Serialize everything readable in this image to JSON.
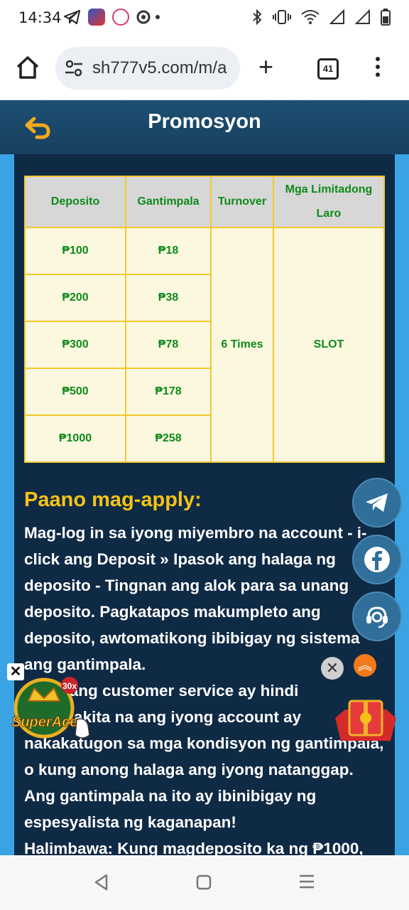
{
  "status_bar": {
    "time": "14:34",
    "left_icons": [
      "telegram-icon",
      "app-badge-icon",
      "app-badge-icon",
      "gear-dot-icon"
    ],
    "right_icons": [
      "bluetooth-icon",
      "vibrate-icon",
      "wifi-icon",
      "signal-icon",
      "signal-icon",
      "battery-icon"
    ]
  },
  "browser": {
    "url": "sh777v5.com/m/a",
    "tab_count": "41"
  },
  "header": {
    "title": "Promosyon"
  },
  "promo_table": {
    "headers": [
      "Deposito",
      "Gantimpala",
      "Turnover",
      "Mga Limitadong Laro"
    ],
    "rows": [
      {
        "deposito": "₱100",
        "gantimpala": "₱18"
      },
      {
        "deposito": "₱200",
        "gantimpala": "₱38"
      },
      {
        "deposito": "₱300",
        "gantimpala": "₱78"
      },
      {
        "deposito": "₱500",
        "gantimpala": "₱178"
      },
      {
        "deposito": "₱1000",
        "gantimpala": "₱258"
      }
    ],
    "turnover": "6 Times",
    "games": "SLOT"
  },
  "apply": {
    "title": "Paano mag-apply:",
    "body": "Mag-log in sa iyong miyembro na account - i-click ang Deposit » Ipasok ang halaga ng deposito - Tingnan ang alok para sa unang deposito. Pagkatapos makumpleto ang deposito, awtomatikong ibibigay ng sistema ang gantimpala.",
    "body2": "Kung ang customer service ay hindi makakakita na ang iyong account ay nakakatugon sa mga kondisyon ng gantimpala, o kung anong halaga ang iyong natanggap. Ang gantimpala na ito ay ibinibigay ng espesyalista ng kaganapan!",
    "example": "Halimbawa: Kung magdeposito ka ng ₱1000,"
  },
  "ads": {
    "game_badge": "30x",
    "game_name": "SuperAce"
  },
  "colors": {
    "header_bg": "#1e4f73",
    "content_bg": "#0f2a45",
    "accent_yellow": "#f5c218",
    "table_green": "#0f8a1a",
    "table_border": "#f2c82e"
  }
}
